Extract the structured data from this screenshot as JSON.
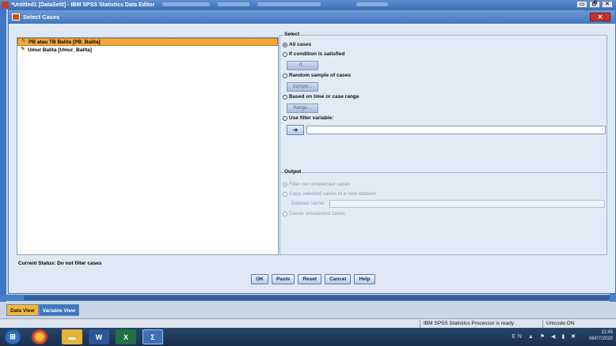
{
  "outer_window": {
    "title": "*Untitled1 [DataSet0] - IBM SPSS Statistics Data Editor",
    "buttons": [
      "▭",
      "🗗",
      "✕"
    ]
  },
  "dialog": {
    "title": "Select Cases",
    "close_label": "✕",
    "variables": [
      {
        "label": "PB atau TB Balita [PB_Balita]",
        "selected": true
      },
      {
        "label": "Umur Balita [Umur_Balita]",
        "selected": false
      }
    ],
    "status": "Current Status: Do not filter cases",
    "select_group": {
      "title": "Select",
      "options": {
        "all_cases": "All cases",
        "if_condition": "If condition is satisfied",
        "if_button": "If...",
        "random_sample": "Random sample of cases",
        "sample_button": "Sample...",
        "based_on_time": "Based on time or case range",
        "range_button": "Range...",
        "use_filter": "Use filter variable:",
        "arrow_button": "➜"
      },
      "selected_option": "all_cases"
    },
    "output_group": {
      "title": "Output",
      "filter_out": "Filter out unselected cases",
      "copy_selected": "Copy selected cases to a new dataset",
      "dataset_name_label": "Dataset name:",
      "delete_unselected": "Delete unselected cases",
      "selected_option": "filter_out"
    },
    "buttons": {
      "ok": "OK",
      "paste": "Paste",
      "reset": "Reset",
      "cancel": "Cancel",
      "help": "Help"
    }
  },
  "view_tabs": {
    "data_view": "Data View",
    "variable_view": "Variable View",
    "active": "data_view"
  },
  "statusbar": {
    "processor": "IBM SPSS Statistics Processor is ready",
    "unicode": "Unicode:ON"
  },
  "taskbar": {
    "tray_lang": "EN",
    "time": "11:45",
    "date": "06/07/2020"
  },
  "colors": {
    "selection_orange": "#f2a93b",
    "titlebar_blue": "#4377bf"
  }
}
